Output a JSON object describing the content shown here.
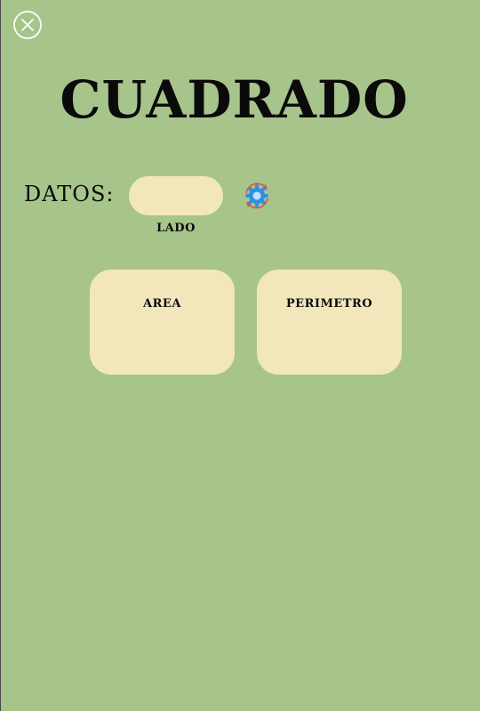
{
  "header": {
    "close_icon": "close-circle-icon",
    "title": "CUADRADO"
  },
  "inputs": {
    "datos_label": "DATOS:",
    "lado": {
      "value": "",
      "placeholder": "",
      "label": "LADO"
    },
    "calculate_icon": "gear-refresh-icon"
  },
  "results": {
    "area": {
      "label": "AREA",
      "value": ""
    },
    "perimetro": {
      "label": "PERIMETRO",
      "value": ""
    }
  },
  "colors": {
    "background": "#a7c48b",
    "card": "#f2e6bb",
    "text": "#0a0a0a",
    "icon_blue": "#2f8fe0",
    "icon_red": "#d9534f"
  }
}
